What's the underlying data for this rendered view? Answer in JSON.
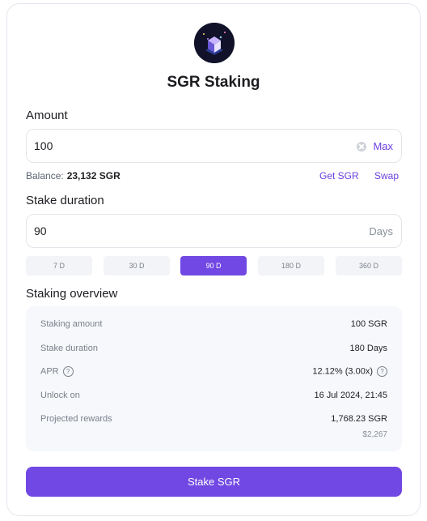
{
  "header": {
    "title": "SGR Staking",
    "logo_icon": "sgr-logo-icon"
  },
  "amount": {
    "label": "Amount",
    "value": "100",
    "max_label": "Max",
    "balance_label": "Balance:",
    "balance_value": "23,132 SGR",
    "get_link": "Get SGR",
    "swap_link": "Swap"
  },
  "duration": {
    "label": "Stake duration",
    "value": "90",
    "unit": "Days",
    "options": [
      "7 D",
      "30 D",
      "90 D",
      "180 D",
      "360 D"
    ],
    "selected": "90 D"
  },
  "overview": {
    "title": "Staking overview",
    "rows": [
      {
        "label": "Staking amount",
        "value": "100 SGR"
      },
      {
        "label": "Stake duration",
        "value": "180 Days"
      },
      {
        "label": "APR",
        "value": "12.12% (3.00x)"
      },
      {
        "label": "Unlock on",
        "value": "16 Jul 2024, 21:45"
      },
      {
        "label": "Projected rewards",
        "value": "1,768.23 SGR",
        "sub": "$2,267"
      }
    ]
  },
  "actions": {
    "stake_label": "Stake SGR"
  },
  "colors": {
    "accent": "#7148e3",
    "link": "#6b3fe0"
  }
}
